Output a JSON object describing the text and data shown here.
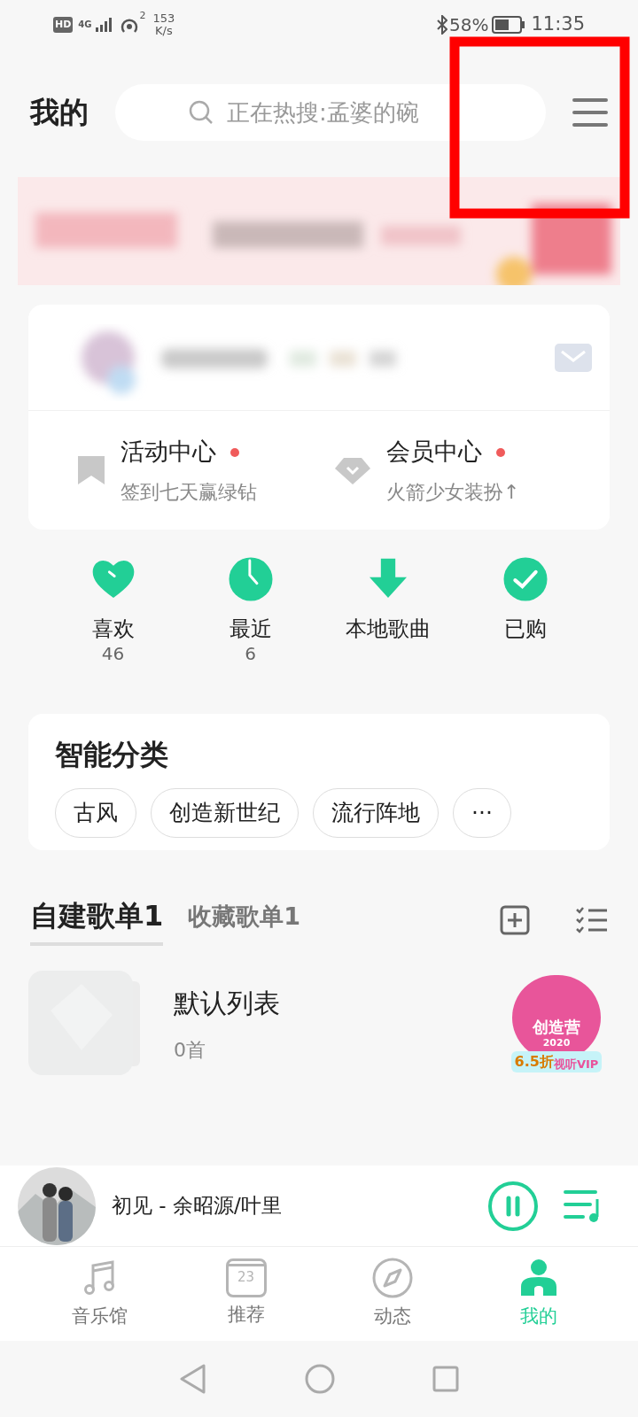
{
  "status_bar": {
    "hd": "HD",
    "network": "4G",
    "hotspot_count": "2",
    "speed": "153",
    "speed_unit": "K/s",
    "battery": "58%",
    "time": "11:35"
  },
  "header": {
    "title": "我的",
    "search": {
      "placeholder": "正在热搜:孟婆的碗"
    }
  },
  "profile_card": {
    "links": [
      {
        "kind": "bookmark",
        "title": "活动中心",
        "subtitle": "签到七天赢绿钻",
        "badge": true
      },
      {
        "kind": "diamond",
        "title": "会员中心",
        "subtitle": "火箭少女装扮↑",
        "badge": true
      }
    ]
  },
  "shortcuts": [
    {
      "kind": "heart",
      "label": "喜欢",
      "count": "46"
    },
    {
      "kind": "clock",
      "label": "最近",
      "count": "6"
    },
    {
      "kind": "download",
      "label": "本地歌曲"
    },
    {
      "kind": "check",
      "label": "已购"
    }
  ],
  "smart_categories": {
    "title": "智能分类",
    "tags": [
      "古风",
      "创造新世纪",
      "流行阵地",
      "···"
    ]
  },
  "playlist_tabs": [
    {
      "label": "自建歌单",
      "count": "1",
      "selected": true
    },
    {
      "label": "收藏歌单",
      "count": "1",
      "selected": false
    }
  ],
  "playlists": [
    {
      "title": "默认列表",
      "subtitle": "0首"
    }
  ],
  "promo": {
    "name": "创造营",
    "year": "2020",
    "discount": "6.5折",
    "text": "视听VIP"
  },
  "now_playing": {
    "track": "初见 - 余昭源/叶里",
    "playing": true
  },
  "bottom_nav": [
    {
      "kind": "music",
      "label": "音乐馆",
      "selected": false
    },
    {
      "kind": "calendar",
      "label": "推荐",
      "day": "23",
      "selected": false
    },
    {
      "kind": "compass",
      "label": "动态",
      "selected": false
    },
    {
      "kind": "person",
      "label": "我的",
      "selected": true
    }
  ]
}
